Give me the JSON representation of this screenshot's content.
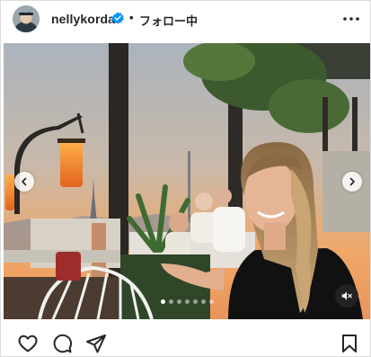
{
  "header": {
    "username": "nellykorda",
    "separator": "•",
    "follow_label": "フォロー中",
    "verified_icon": "verified-badge-icon",
    "more_icon": "more-options-icon",
    "avatar_alt": "nellykorda profile picture"
  },
  "media": {
    "carousel": {
      "slide_count": 7,
      "active_index": 0,
      "prev_icon": "chevron-left-icon",
      "next_icon": "chevron-right-icon"
    },
    "mute_icon": "speaker-muted-icon"
  },
  "actions": {
    "like_icon": "heart-icon",
    "comment_icon": "comment-bubble-icon",
    "share_icon": "paper-plane-icon",
    "save_icon": "bookmark-icon"
  },
  "colors": {
    "verified": "#0095f6",
    "text": "#262626",
    "border": "#dbdbdb",
    "sunset": "#f2a36a"
  }
}
